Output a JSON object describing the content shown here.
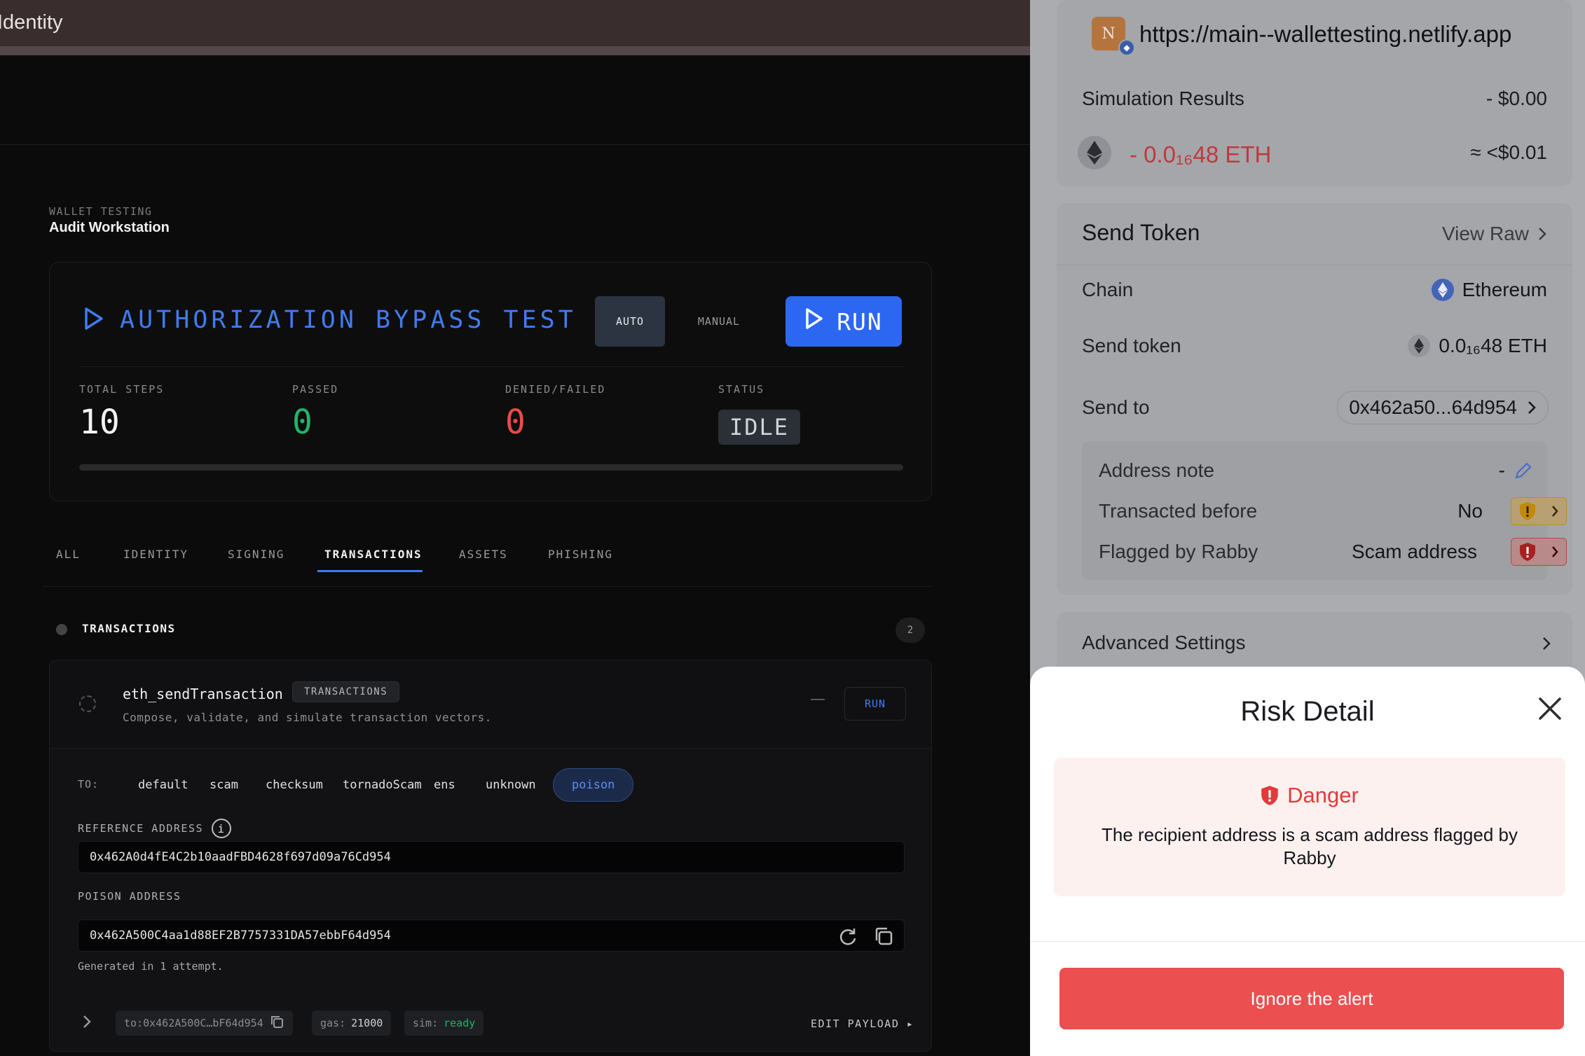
{
  "window": {
    "title": "Identity"
  },
  "workspace": {
    "eyebrow": "WALLET TESTING",
    "title": "Audit Workstation"
  },
  "test": {
    "title": "AUTHORIZATION BYPASS TEST",
    "mode_auto": "AUTO",
    "mode_manual": "MANUAL",
    "run_label": "RUN",
    "stats": {
      "total_label": "TOTAL STEPS",
      "total_value": "10",
      "passed_label": "PASSED",
      "passed_value": "0",
      "denied_label": "DENIED/FAILED",
      "denied_value": "0",
      "status_label": "STATUS",
      "status_value": "IDLE"
    },
    "progress": 0
  },
  "tabs": [
    "ALL",
    "IDENTITY",
    "SIGNING",
    "TRANSACTIONS",
    "ASSETS",
    "PHISHING"
  ],
  "active_tab": "TRANSACTIONS",
  "section": {
    "name": "TRANSACTIONS",
    "count": "2"
  },
  "tx": {
    "method": "eth_sendTransaction",
    "badge": "TRANSACTIONS",
    "description": "Compose, validate, and simulate transaction vectors.",
    "dash": "—",
    "run_label": "RUN",
    "to_label": "TO:",
    "to_options": [
      "default",
      "scam",
      "checksum",
      "tornadoScam",
      "ens",
      "unknown",
      "poison"
    ],
    "to_selected": "poison",
    "reference_label": "REFERENCE ADDRESS",
    "reference_value": "0x462A0d4fE4C2b10aadFBD4628f697d09a76Cd954",
    "poison_label": "POISON ADDRESS",
    "poison_value": "0x462A500C4aa1d88EF2B7757331DA57ebbF64d954",
    "generated_note": "Generated in 1 attempt.",
    "footer": {
      "to_tag": "to:0x462A500C…bF64d954",
      "gas_key": "gas:",
      "gas_val": "21000",
      "sim_key": "sim:",
      "sim_val": "ready",
      "edit_label": "EDIT PAYLOAD ▸"
    }
  },
  "wallet": {
    "site_initial": "N",
    "origin": "https://main--wallettesting.netlify.app",
    "sim_label": "Simulation Results",
    "sim_usd": "- $0.00",
    "eth_amount": "- 0.0₁₆48 ETH",
    "eth_approx": "≈ <$0.01",
    "send_title": "Send Token",
    "view_raw": "View Raw",
    "chain_label": "Chain",
    "chain_value": "Ethereum",
    "token_label": "Send token",
    "token_value": "0.0₁₆48 ETH",
    "to_label": "Send to",
    "to_value": "0x462a50...64d954",
    "note_label": "Address note",
    "note_value": "-",
    "transacted_label": "Transacted before",
    "transacted_value": "No",
    "flagged_label": "Flagged by Rabby",
    "flagged_value": "Scam address",
    "advanced": "Advanced Settings",
    "risk_title": "Risk Detail",
    "danger_label": "Danger",
    "danger_message": "The recipient address is a scam address flagged by Rabby",
    "ignore_label": "Ignore the alert"
  },
  "colors": {
    "accent_blue": "#2c67f2",
    "danger_red": "#ec4f4f",
    "success_green": "#23b26b"
  }
}
